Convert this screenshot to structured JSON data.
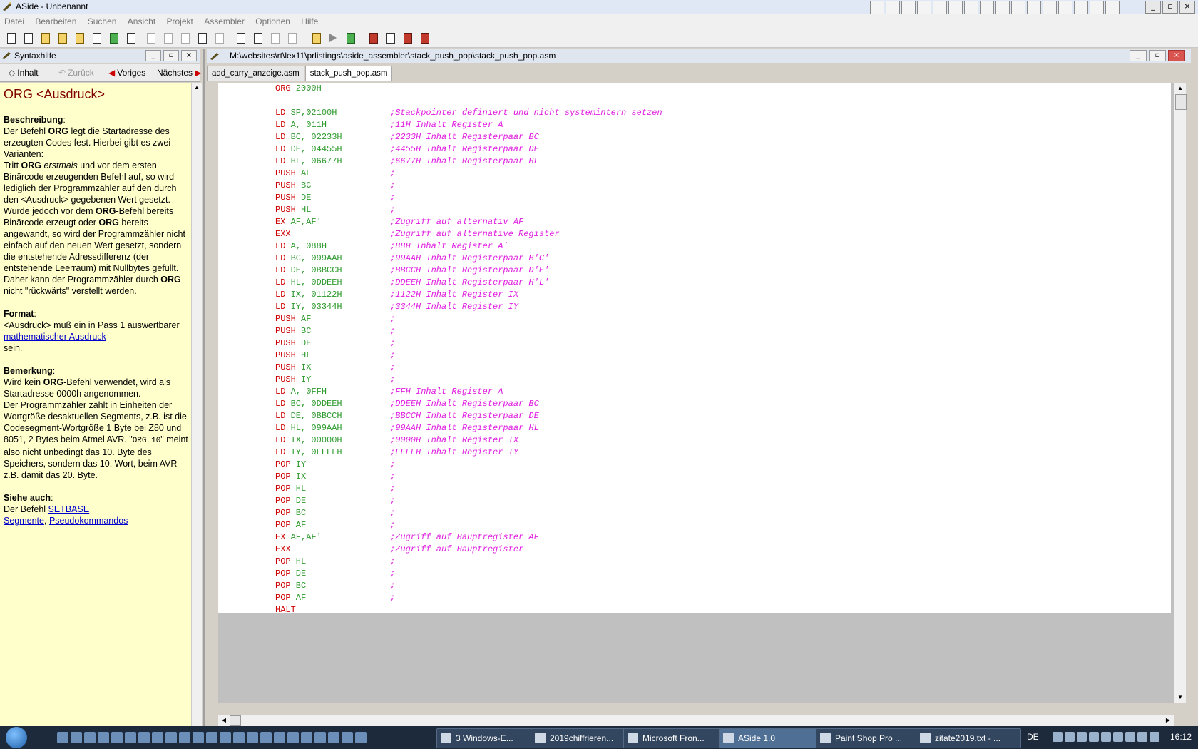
{
  "window": {
    "title": "ASide - Unbenannt"
  },
  "menu": [
    "Datei",
    "Bearbeiten",
    "Suchen",
    "Ansicht",
    "Projekt",
    "Assembler",
    "Optionen",
    "Hilfe"
  ],
  "help_panel": {
    "title": "Syntaxhilfe",
    "nav": {
      "contents": "Inhalt",
      "back": "Zurück",
      "previous": "Voriges",
      "next": "Nächstes"
    },
    "heading": "ORG <Ausdruck>",
    "desc_title": "Beschreibung",
    "desc_p1_a": "Der Befehl ",
    "desc_p1_b": "ORG",
    "desc_p1_c": " legt die Startadresse des erzeugten Codes fest. Hierbei gibt es zwei Varianten:",
    "desc_p2_a": "Tritt ",
    "desc_p2_b": "ORG",
    "desc_p2_c": " erstmals",
    "desc_p2_d": " und vor dem ersten Binärcode erzeugenden Befehl auf, so wird lediglich der Programmzähler auf den durch den <Ausdruck> gegebenen Wert gesetzt.",
    "desc_p3_a": "Wurde jedoch vor dem ",
    "desc_p3_b": "ORG",
    "desc_p3_c": "-Befehl bereits Binärcode erzeugt oder ",
    "desc_p3_d": "ORG",
    "desc_p3_e": " bereits angewandt, so wird der Programmzähler nicht einfach auf den neuen Wert gesetzt, sondern die entstehende Adressdifferenz (der entstehende Leerraum) mit Nullbytes gefüllt. Daher kann der Programmzähler durch ",
    "desc_p3_f": "ORG",
    "desc_p3_g": " nicht \"rückwärts\" verstellt werden.",
    "format_title": "Format",
    "format_a": "<Ausdruck> muß ein in Pass 1 auswertbarer ",
    "format_link": "mathematischer Ausdruck",
    "format_b": " sein.",
    "remark_title": "Bemerkung",
    "remark_a": "Wird kein ",
    "remark_b": "ORG",
    "remark_c": "-Befehl verwendet, wird als Startadresse 0000h angenommen.",
    "remark_d": "Der Programmzähler zählt in Einheiten der Wortgröße desaktuellen Segments, z.B. ist die Codesegment-Wortgröße 1 Byte bei Z80 und 8051, 2 Bytes beim Atmel AVR. \"",
    "remark_code": "ORG 10",
    "remark_e": "\" meint also nicht unbedingt das 10. Byte des Speichers, sondern das 10. Wort, beim AVR z.B. damit das 20. Byte.",
    "see_title": "Siehe auch",
    "see_a": "Der Befehl ",
    "see_link1": "SETBASE",
    "see_link2": "Segmente",
    "see_sep": ", ",
    "see_link3": "Pseudokommandos"
  },
  "editor": {
    "path": "M:\\websites\\rt\\lex11\\prlistings\\aside_assembler\\stack_push_pop\\stack_push_pop.asm",
    "tabs": [
      "add_carry_anzeige.asm",
      "stack_push_pop.asm"
    ],
    "lines": [
      {
        "op": "ORG",
        "arg": " 2000H",
        "cm": ""
      },
      {
        "op": "",
        "arg": "",
        "cm": ""
      },
      {
        "op": "LD",
        "arg": " SP,02100H",
        "cm": ";Stackpointer definiert und nicht systemintern setzen"
      },
      {
        "op": "LD",
        "arg": " A, 011H",
        "cm": ";11H Inhalt Register A"
      },
      {
        "op": "LD",
        "arg": " BC, 02233H",
        "cm": ";2233H Inhalt Registerpaar BC"
      },
      {
        "op": "LD",
        "arg": " DE, 04455H",
        "cm": ";4455H Inhalt Registerpaar DE"
      },
      {
        "op": "LD",
        "arg": " HL, 06677H",
        "cm": ";6677H Inhalt Registerpaar HL"
      },
      {
        "op": "PUSH",
        "arg": " AF",
        "cm": ";"
      },
      {
        "op": "PUSH",
        "arg": " BC",
        "cm": ";"
      },
      {
        "op": "PUSH",
        "arg": " DE",
        "cm": ";"
      },
      {
        "op": "PUSH",
        "arg": " HL",
        "cm": ";"
      },
      {
        "op": "EX",
        "arg": " AF,AF'",
        "cm": ";Zugriff auf alternativ AF"
      },
      {
        "op": "EXX",
        "arg": "",
        "cm": ";Zugriff auf alternative Register"
      },
      {
        "op": "LD",
        "arg": " A, 088H",
        "cm": ";88H Inhalt Register A'"
      },
      {
        "op": "LD",
        "arg": " BC, 099AAH",
        "cm": ";99AAH Inhalt Registerpaar B'C'"
      },
      {
        "op": "LD",
        "arg": " DE, 0BBCCH",
        "cm": ";BBCCH Inhalt Registerpaar D'E'"
      },
      {
        "op": "LD",
        "arg": " HL, 0DDEEH",
        "cm": ";DDEEH Inhalt Registerpaar H'L'"
      },
      {
        "op": "LD",
        "arg": " IX, 01122H",
        "cm": ";1122H Inhalt Register IX"
      },
      {
        "op": "LD",
        "arg": " IY, 03344H",
        "cm": ";3344H Inhalt Register IY"
      },
      {
        "op": "PUSH",
        "arg": " AF",
        "cm": ";"
      },
      {
        "op": "PUSH",
        "arg": " BC",
        "cm": ";"
      },
      {
        "op": "PUSH",
        "arg": " DE",
        "cm": ";"
      },
      {
        "op": "PUSH",
        "arg": " HL",
        "cm": ";"
      },
      {
        "op": "PUSH",
        "arg": " IX",
        "cm": ";"
      },
      {
        "op": "PUSH",
        "arg": " IY",
        "cm": ";"
      },
      {
        "op": "LD",
        "arg": " A, 0FFH",
        "cm": ";FFH Inhalt Register A"
      },
      {
        "op": "LD",
        "arg": " BC, 0DDEEH",
        "cm": ";DDEEH Inhalt Registerpaar BC"
      },
      {
        "op": "LD",
        "arg": " DE, 0BBCCH",
        "cm": ";BBCCH Inhalt Registerpaar DE"
      },
      {
        "op": "LD",
        "arg": " HL, 099AAH",
        "cm": ";99AAH Inhalt Registerpaar HL"
      },
      {
        "op": "LD",
        "arg": " IX, 00000H",
        "cm": ";0000H Inhalt Register IX"
      },
      {
        "op": "LD",
        "arg": " IY, 0FFFFH",
        "cm": ";FFFFH Inhalt Register IY"
      },
      {
        "op": "POP",
        "arg": " IY",
        "cm": ";"
      },
      {
        "op": "POP",
        "arg": " IX",
        "cm": ";"
      },
      {
        "op": "POP",
        "arg": " HL",
        "cm": ";"
      },
      {
        "op": "POP",
        "arg": " DE",
        "cm": ";"
      },
      {
        "op": "POP",
        "arg": " BC",
        "cm": ";"
      },
      {
        "op": "POP",
        "arg": " AF",
        "cm": ";"
      },
      {
        "op": "EX",
        "arg": " AF,AF'",
        "cm": ";Zugriff auf Hauptregister AF"
      },
      {
        "op": "EXX",
        "arg": "",
        "cm": ";Zugriff auf Hauptregister"
      },
      {
        "op": "POP",
        "arg": " HL",
        "cm": ";"
      },
      {
        "op": "POP",
        "arg": " DE",
        "cm": ";"
      },
      {
        "op": "POP",
        "arg": " BC",
        "cm": ";"
      },
      {
        "op": "POP",
        "arg": " AF",
        "cm": ";"
      },
      {
        "op": "HALT",
        "arg": "",
        "cm": ""
      }
    ]
  },
  "taskbar": {
    "tasks": [
      "3 Windows-E...",
      "2019chiffrieren...",
      "Microsoft Fron...",
      "ASide 1.0",
      "Paint Shop Pro ...",
      "zitate2019.txt - ..."
    ],
    "lang": "DE",
    "time": "16:12"
  },
  "colors": {
    "help_bg": "#ffffcc",
    "heading": "#800000",
    "opcode": "#cc0000",
    "operand": "#2e9a2e",
    "comment": "#e020e0"
  }
}
